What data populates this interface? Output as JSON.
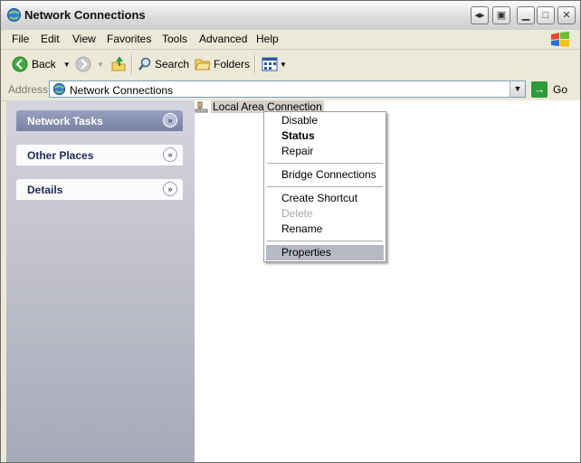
{
  "window": {
    "title": "Network Connections"
  },
  "menubar": {
    "items": [
      "File",
      "Edit",
      "View",
      "Favorites",
      "Tools",
      "Advanced",
      "Help"
    ]
  },
  "toolbar": {
    "back_label": "Back",
    "search_label": "Search",
    "folders_label": "Folders"
  },
  "addressbar": {
    "label": "Address",
    "value": "Network Connections",
    "go_label": "Go"
  },
  "leftpane": {
    "tasks": [
      {
        "label": "Network Tasks",
        "state": "active"
      },
      {
        "label": "Other Places",
        "state": "collapsed"
      },
      {
        "label": "Details",
        "state": "collapsed"
      }
    ]
  },
  "content": {
    "item_label": "Local Area Connection"
  },
  "contextmenu": {
    "items": [
      {
        "label": "Disable",
        "style": "normal"
      },
      {
        "label": "Status",
        "style": "bold"
      },
      {
        "label": "Repair",
        "style": "normal"
      },
      {
        "label": "Bridge Connections",
        "style": "normal"
      },
      {
        "label": "Create Shortcut",
        "style": "normal"
      },
      {
        "label": "Delete",
        "style": "disabled"
      },
      {
        "label": "Rename",
        "style": "normal"
      },
      {
        "label": "Properties",
        "style": "highlight"
      }
    ]
  },
  "colors": {
    "accent": "#7a82a3",
    "go_green": "#2f9a3a",
    "menu_highlight": "#b6b8c4"
  }
}
